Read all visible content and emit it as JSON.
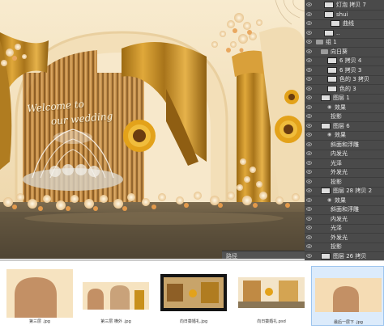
{
  "canvas": {
    "welcome_line1": "Welcome to",
    "welcome_line2": "our wedding"
  },
  "layers_panel": {
    "items": [
      {
        "label": "灯泡 拷贝 7",
        "selected": false
      },
      {
        "label": "shui",
        "selected": false
      },
      {
        "label": "曲线",
        "selected": false
      },
      {
        "label": "..",
        "selected": false
      },
      {
        "label": "组 1",
        "selected": false
      },
      {
        "label": "向日葵",
        "selected": false
      },
      {
        "label": "6 拷贝 4",
        "selected": false
      },
      {
        "label": "6 拷贝 3",
        "selected": false
      },
      {
        "label": "色的 3 拷贝",
        "selected": false
      },
      {
        "label": "色的 3",
        "selected": false
      },
      {
        "label": "图层 1",
        "selected": false
      },
      {
        "label": "效果",
        "selected": false
      },
      {
        "label": "投影",
        "selected": false
      },
      {
        "label": "图层 6",
        "selected": false
      },
      {
        "label": "效果",
        "selected": false
      },
      {
        "label": "斜面和浮雕",
        "selected": false
      },
      {
        "label": "内发光",
        "selected": false
      },
      {
        "label": "光泽",
        "selected": false
      },
      {
        "label": "外发光",
        "selected": false
      },
      {
        "label": "投影",
        "selected": false
      },
      {
        "label": "图层 28 拷贝 2",
        "selected": false
      },
      {
        "label": "效果",
        "selected": false
      },
      {
        "label": "斜面和浮雕",
        "selected": false
      },
      {
        "label": "内发光",
        "selected": false
      },
      {
        "label": "光泽",
        "selected": false
      },
      {
        "label": "外发光",
        "selected": false
      },
      {
        "label": "投影",
        "selected": false
      },
      {
        "label": "图层 26 拷贝",
        "selected": false
      }
    ],
    "path_tab": "路径"
  },
  "file_strip": {
    "files": [
      {
        "name": "第三层 .jpg",
        "selected": false
      },
      {
        "name": "第三层 横外 .jpg",
        "selected": false
      },
      {
        "name": "向日葵婚礼.jpg",
        "selected": false
      },
      {
        "name": "向日葵婚礼.psd",
        "selected": false
      },
      {
        "name": "最后一层下 .jpg",
        "selected": true
      }
    ]
  },
  "colors": {
    "background_cream": "#f6e4c2",
    "curtain_gold": "#c8901c",
    "arch_tan": "#c39065",
    "panel_dark": "#4a4a4a",
    "selection_blue": "#dcebfb"
  },
  "icons": [
    "eye-icon",
    "layer-thumbnail",
    "folder-icon",
    "effects-icon"
  ]
}
